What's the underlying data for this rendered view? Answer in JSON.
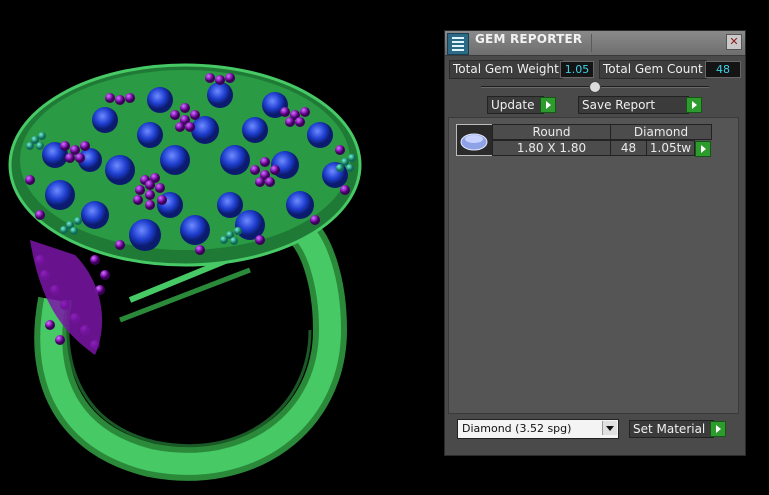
{
  "panel": {
    "title": "GEM REPORTER",
    "close_label": "✕",
    "total_weight_label": "Total Gem Weight",
    "total_weight_value": "1.05",
    "total_count_label": "Total Gem Count",
    "total_count_value": "48",
    "update_label": "Update",
    "save_report_label": "Save Report",
    "table": {
      "headers": [
        "Round",
        "Diamond"
      ],
      "rows": [
        {
          "size": "1.80 X 1.80",
          "count": "48",
          "weight": "1.05tw"
        }
      ]
    },
    "material_select_value": "Diamond     (3.52 spg)",
    "set_material_label": "Set Material"
  },
  "colors": {
    "panel_bg": "#4a4a4a",
    "value_text": "#3fd0e6",
    "go_button": "#2d9b2d",
    "metal": "#2fae4f",
    "gem_blue": "#1f3fd0",
    "bead_purple": "#8a1bb8",
    "accent_teal": "#1aa58a"
  },
  "icons": {
    "title": "gem-reporter-icon",
    "close": "close-icon",
    "go": "play-arrow-icon",
    "thumb": "round-gem-icon",
    "dropdown": "chevron-down-icon"
  }
}
